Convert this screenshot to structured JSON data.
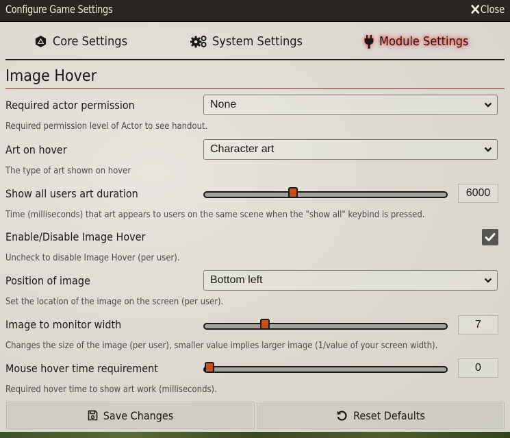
{
  "window": {
    "title": "Configure Game Settings",
    "close_label": "Close"
  },
  "tabs": [
    {
      "label": "Core Settings",
      "icon": "d20-icon",
      "active": false
    },
    {
      "label": "System Settings",
      "icon": "cogs-icon",
      "active": false
    },
    {
      "label": "Module Settings",
      "icon": "plug-icon",
      "active": true
    }
  ],
  "section": {
    "title": "Image Hover"
  },
  "settings": [
    {
      "label": "Required actor permission",
      "type": "select",
      "value": "None",
      "hint": "Required permission level of Actor to see handout."
    },
    {
      "label": "Art on hover",
      "type": "select",
      "value": "Character art",
      "hint": "The type of art shown on hover"
    },
    {
      "label": "Show all users art duration",
      "type": "range",
      "value": "6000",
      "fraction": 0.36,
      "hint": "Time (milliseconds) that art appears to users on the same scene when the \"show all\" keybind is pressed."
    },
    {
      "label": "Enable/Disable Image Hover",
      "type": "checkbox",
      "checked": true,
      "hint": "Uncheck to disable Image Hover (per user)."
    },
    {
      "label": "Position of image",
      "type": "select",
      "value": "Bottom left",
      "hint": "Set the location of the image on the screen (per user)."
    },
    {
      "label": "Image to monitor width",
      "type": "range",
      "value": "7",
      "fraction": 0.24,
      "hint": "Changes the size of the image (per user), smaller value implies larger image (1/value of your screen width)."
    },
    {
      "label": "Mouse hover time requirement",
      "type": "range",
      "value": "0",
      "fraction": 0.0,
      "hint": "Required hover time to show art work (milliseconds)."
    }
  ],
  "footer": {
    "save_label": "Save Changes",
    "reset_label": "Reset Defaults"
  },
  "colors": {
    "accent": "#c9501b",
    "active_tab_glow": "#ff3030",
    "header_rule": "#a23020",
    "titlebar": "#2a2723"
  }
}
